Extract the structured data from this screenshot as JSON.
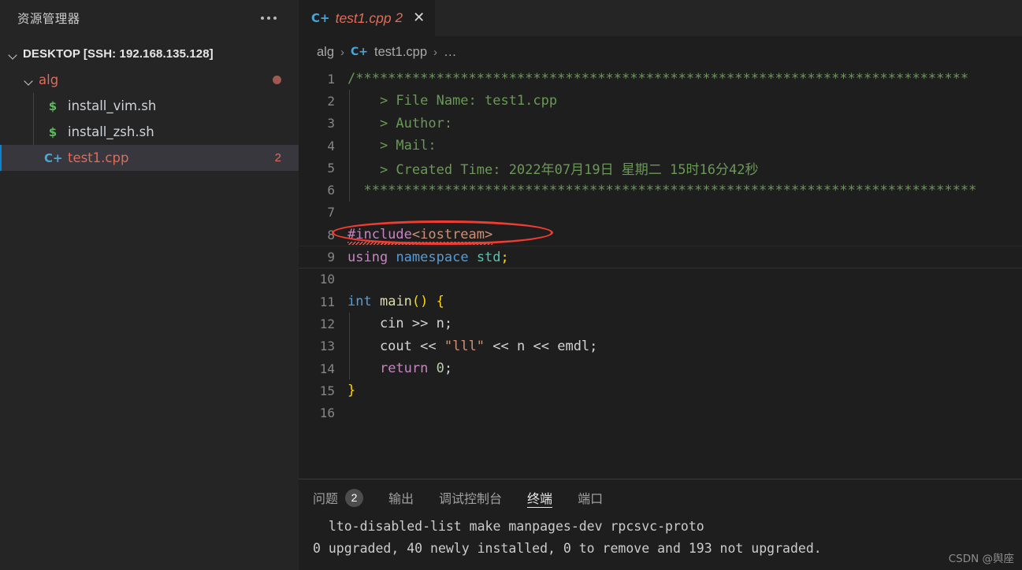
{
  "sidebar": {
    "title": "资源管理器",
    "more_actions_icon": "ellipsis-icon",
    "root": {
      "label": "DESKTOP [SSH: 192.168.135.128]",
      "expanded": true
    },
    "folder": {
      "label": "alg",
      "expanded": true,
      "badge_icon": "error-dot"
    },
    "files": [
      {
        "name": "install_vim.sh",
        "icon": "shell-script-icon",
        "icon_glyph": "$",
        "badge": ""
      },
      {
        "name": "install_zsh.sh",
        "icon": "shell-script-icon",
        "icon_glyph": "$",
        "badge": ""
      },
      {
        "name": "test1.cpp",
        "icon": "cpp-file-icon",
        "icon_glyph": "C+",
        "badge": "2",
        "selected": true
      }
    ]
  },
  "tabs": [
    {
      "icon": "cpp-file-icon",
      "icon_glyph": "C+",
      "label": "test1.cpp",
      "badge": "2",
      "close_icon": "close-icon",
      "close_glyph": "✕",
      "active": true,
      "preview": true
    }
  ],
  "breadcrumb": {
    "items": [
      {
        "label": "alg",
        "icon": ""
      },
      {
        "label": "test1.cpp",
        "icon": "cpp-file-icon",
        "icon_glyph": "C+"
      },
      {
        "label": "…",
        "icon": ""
      }
    ],
    "separator": "›"
  },
  "editor": {
    "current_line": 9,
    "lines": [
      {
        "n": "1",
        "tokens": [
          {
            "t": "/****************************************************************************",
            "c": "c-com"
          }
        ]
      },
      {
        "n": "2",
        "tokens": [
          {
            "t": "    > File Name: test1.cpp",
            "c": "c-com"
          }
        ],
        "guide": true
      },
      {
        "n": "3",
        "tokens": [
          {
            "t": "    > Author: ",
            "c": "c-com"
          }
        ],
        "guide": true
      },
      {
        "n": "4",
        "tokens": [
          {
            "t": "    > Mail: ",
            "c": "c-com"
          }
        ],
        "guide": true
      },
      {
        "n": "5",
        "tokens": [
          {
            "t": "    > Created Time: 2022年07月19日 星期二 15时16分42秒",
            "c": "c-com"
          }
        ],
        "guide": true
      },
      {
        "n": "6",
        "tokens": [
          {
            "t": "  ****************************************************************************",
            "c": "c-com"
          }
        ],
        "guide": true
      },
      {
        "n": "7",
        "tokens": []
      },
      {
        "n": "8",
        "tokens": [
          {
            "t": "#include",
            "c": "c-pre"
          },
          {
            "t": "<iostream>",
            "c": "c-inc"
          }
        ],
        "squiggle": true,
        "annotated": true
      },
      {
        "n": "9",
        "tokens": [
          {
            "t": "using",
            "c": "c-pre"
          },
          {
            "t": " ",
            "c": "c-plain"
          },
          {
            "t": "namespace",
            "c": "c-key"
          },
          {
            "t": " ",
            "c": "c-plain"
          },
          {
            "t": "std",
            "c": "c-type"
          },
          {
            "t": ";",
            "c": "c-brc"
          }
        ],
        "current": true
      },
      {
        "n": "10",
        "tokens": []
      },
      {
        "n": "11",
        "tokens": [
          {
            "t": "int",
            "c": "c-key"
          },
          {
            "t": " ",
            "c": "c-plain"
          },
          {
            "t": "main",
            "c": "c-fn"
          },
          {
            "t": "()",
            "c": "c-brc"
          },
          {
            "t": " ",
            "c": "c-plain"
          },
          {
            "t": "{",
            "c": "c-brc"
          }
        ]
      },
      {
        "n": "12",
        "tokens": [
          {
            "t": "    cin ",
            "c": "c-plain"
          },
          {
            "t": ">>",
            "c": "c-plain"
          },
          {
            "t": " n;",
            "c": "c-plain"
          }
        ],
        "guide": true
      },
      {
        "n": "13",
        "tokens": [
          {
            "t": "    cout ",
            "c": "c-plain"
          },
          {
            "t": "<<",
            "c": "c-plain"
          },
          {
            "t": " ",
            "c": "c-plain"
          },
          {
            "t": "\"lll\"",
            "c": "c-str"
          },
          {
            "t": " ",
            "c": "c-plain"
          },
          {
            "t": "<<",
            "c": "c-plain"
          },
          {
            "t": " n ",
            "c": "c-plain"
          },
          {
            "t": "<<",
            "c": "c-plain"
          },
          {
            "t": " emdl;",
            "c": "c-plain"
          }
        ],
        "guide": true
      },
      {
        "n": "14",
        "tokens": [
          {
            "t": "    ",
            "c": "c-plain"
          },
          {
            "t": "return",
            "c": "c-pre"
          },
          {
            "t": " ",
            "c": "c-plain"
          },
          {
            "t": "0",
            "c": "c-num"
          },
          {
            "t": ";",
            "c": "c-plain"
          }
        ],
        "guide": true
      },
      {
        "n": "15",
        "tokens": [
          {
            "t": "}",
            "c": "c-brc"
          }
        ]
      },
      {
        "n": "16",
        "tokens": []
      }
    ],
    "annotation": {
      "type": "red-ellipse",
      "color": "#f03c32",
      "target_line": "8",
      "target_text": "#include<iostream>"
    }
  },
  "panel": {
    "tabs": [
      {
        "label": "问题",
        "badge": "2",
        "active": false
      },
      {
        "label": "输出",
        "badge": "",
        "active": false
      },
      {
        "label": "调试控制台",
        "badge": "",
        "active": false
      },
      {
        "label": "终端",
        "badge": "",
        "active": true
      },
      {
        "label": "端口",
        "badge": "",
        "active": false
      }
    ],
    "terminal_lines": [
      "  lto-disabled-list make manpages-dev rpcsvc-proto",
      "0 upgraded, 40 newly installed, 0 to remove and 193 not upgraded."
    ]
  },
  "watermark": "CSDN @舆座",
  "colors": {
    "editor_bg": "#1e1e1e",
    "sidebar_bg": "#252526",
    "selection_bg": "#37373d",
    "accent": "#0a85d1",
    "error": "#e06c57",
    "annotation": "#f03c32",
    "comment": "#6a9955"
  }
}
